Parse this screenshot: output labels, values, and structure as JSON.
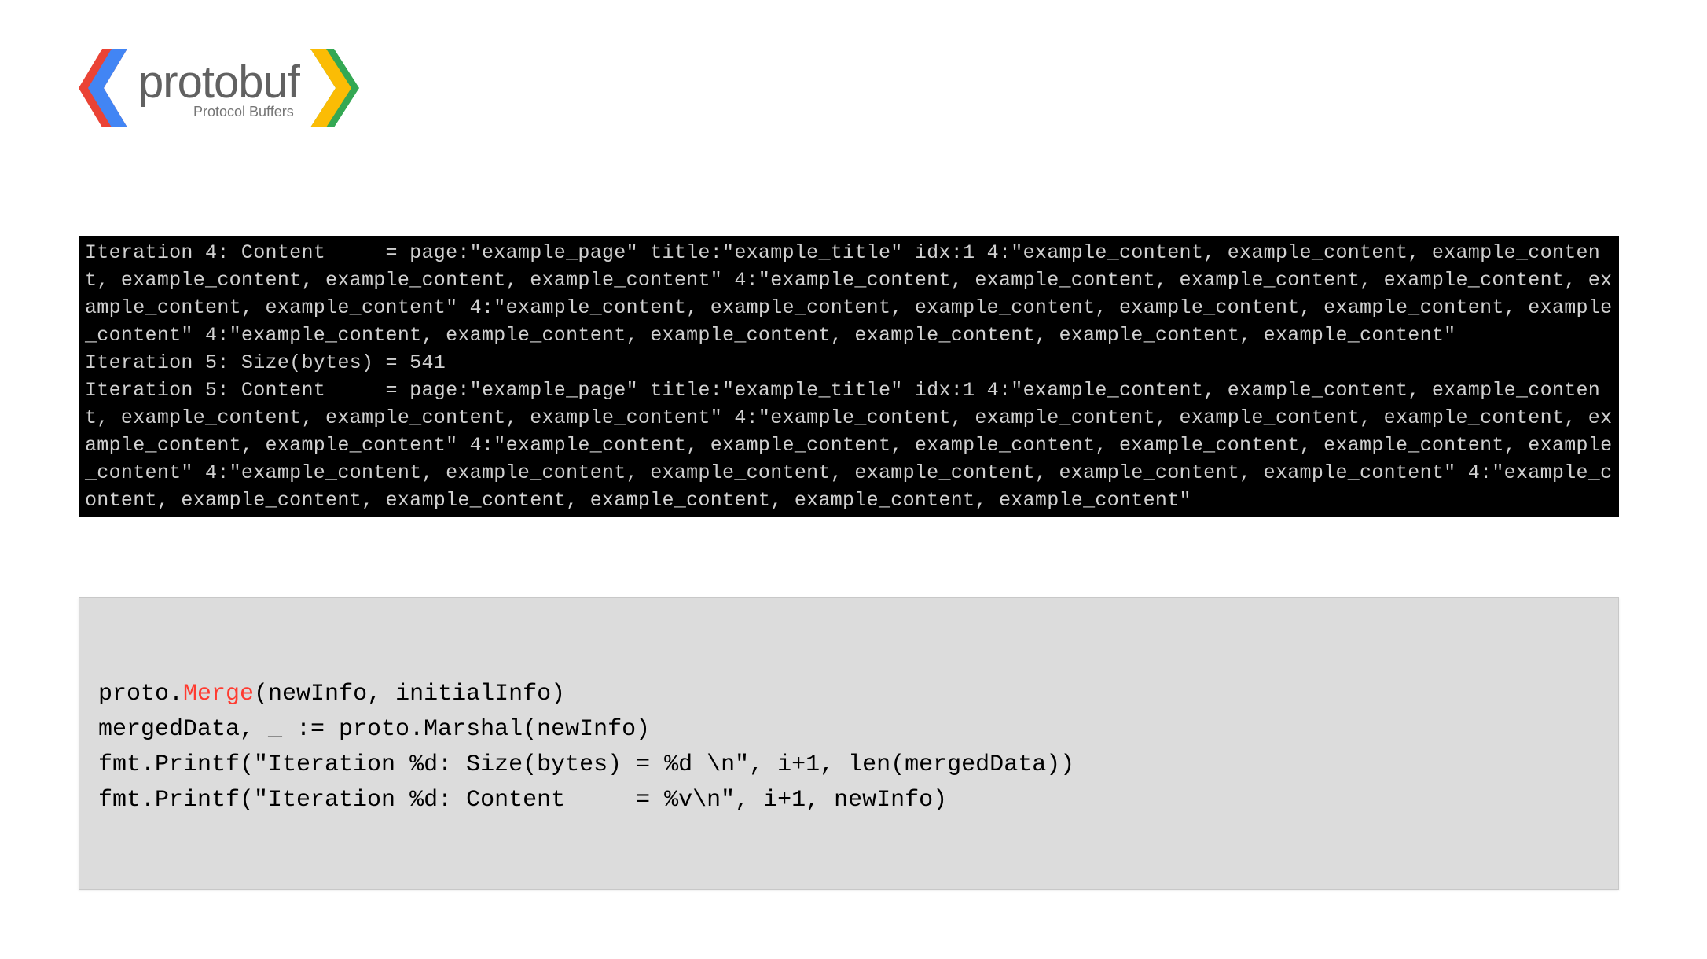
{
  "logo": {
    "word": "protobuf",
    "subtitle": "Protocol Buffers"
  },
  "terminal": {
    "text": "Iteration 4: Content     = page:\"example_page\" title:\"example_title\" idx:1 4:\"example_content, example_content, example_content, example_content, example_content, example_content\" 4:\"example_content, example_content, example_content, example_content, example_content, example_content\" 4:\"example_content, example_content, example_content, example_content, example_content, example_content\" 4:\"example_content, example_content, example_content, example_content, example_content, example_content\"\nIteration 5: Size(bytes) = 541\nIteration 5: Content     = page:\"example_page\" title:\"example_title\" idx:1 4:\"example_content, example_content, example_content, example_content, example_content, example_content\" 4:\"example_content, example_content, example_content, example_content, example_content, example_content\" 4:\"example_content, example_content, example_content, example_content, example_content, example_content\" 4:\"example_content, example_content, example_content, example_content, example_content, example_content\" 4:\"example_content, example_content, example_content, example_content, example_content, example_content\""
  },
  "code": {
    "l1_pre": "proto.",
    "l1_merge": "Merge",
    "l1_post": "(newInfo, initialInfo)",
    "l2": "mergedData, _ := proto.Marshal(newInfo)",
    "l3": "fmt.Printf(\"Iteration %d: Size(bytes) = %d \\n\", i+1, len(mergedData))",
    "l4": "fmt.Printf(\"Iteration %d: Content     = %v\\n\", i+1, newInfo)"
  }
}
